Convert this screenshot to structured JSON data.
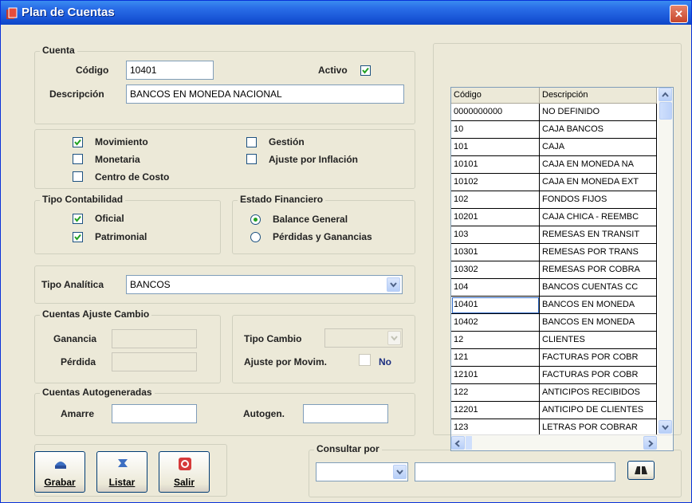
{
  "window": {
    "title": "Plan de Cuentas"
  },
  "cuenta": {
    "legend": "Cuenta",
    "codigo_label": "Código",
    "codigo_value": "10401",
    "activo_label": "Activo",
    "descripcion_label": "Descripción",
    "descripcion_value": "BANCOS EN MONEDA NACIONAL"
  },
  "flags": {
    "movimiento": "Movimiento",
    "monetaria": "Monetaria",
    "centro_costo": "Centro de Costo",
    "gestion": "Gestión",
    "ajuste_inflacion": "Ajuste por Inflación"
  },
  "tipo_contabilidad": {
    "legend": "Tipo Contabilidad",
    "oficial": "Oficial",
    "patrimonial": "Patrimonial"
  },
  "estado_financiero": {
    "legend": "Estado Financiero",
    "balance": "Balance General",
    "perdidas": "Pérdidas y Ganancias"
  },
  "analitica": {
    "label": "Tipo Analítica",
    "value": "BANCOS"
  },
  "ajuste_cambio": {
    "legend": "Cuentas Ajuste Cambio",
    "ganancia": "Ganancia",
    "perdida": "Pérdida",
    "tipo_cambio": "Tipo Cambio",
    "ajuste_movim": "Ajuste por Movim.",
    "no": "No"
  },
  "autogeneradas": {
    "legend": "Cuentas Autogeneradas",
    "amarre": "Amarre",
    "autogen": "Autogen."
  },
  "consultar": {
    "legend": "Consultar por"
  },
  "buttons": {
    "grabar": "Grabar",
    "listar": "Listar",
    "salir": "Salir"
  },
  "grid": {
    "col_codigo": "Código",
    "col_descripcion": "Descripción",
    "rows": [
      [
        "0000000000",
        "NO DEFINIDO"
      ],
      [
        "10",
        "CAJA BANCOS"
      ],
      [
        "101",
        "CAJA"
      ],
      [
        "10101",
        "CAJA  EN MONEDA NA"
      ],
      [
        "10102",
        "CAJA EN MONEDA EXT"
      ],
      [
        "102",
        "FONDOS FIJOS"
      ],
      [
        "10201",
        "CAJA CHICA - REEMBC"
      ],
      [
        "103",
        "REMESAS EN TRANSIT"
      ],
      [
        "10301",
        "REMESAS POR TRANS"
      ],
      [
        "10302",
        "REMESAS POR COBRA"
      ],
      [
        "104",
        "BANCOS CUENTAS CC"
      ],
      [
        "10401",
        "BANCOS EN MONEDA"
      ],
      [
        "10402",
        "BANCOS EN MONEDA"
      ],
      [
        "12",
        "CLIENTES"
      ],
      [
        "121",
        "FACTURAS POR COBR"
      ],
      [
        "12101",
        "FACTURAS POR COBR"
      ],
      [
        "122",
        "ANTICIPOS RECIBIDOS"
      ],
      [
        "12201",
        "ANTICIPO DE CLIENTES"
      ],
      [
        "123",
        "LETRAS POR COBRAR"
      ]
    ]
  }
}
